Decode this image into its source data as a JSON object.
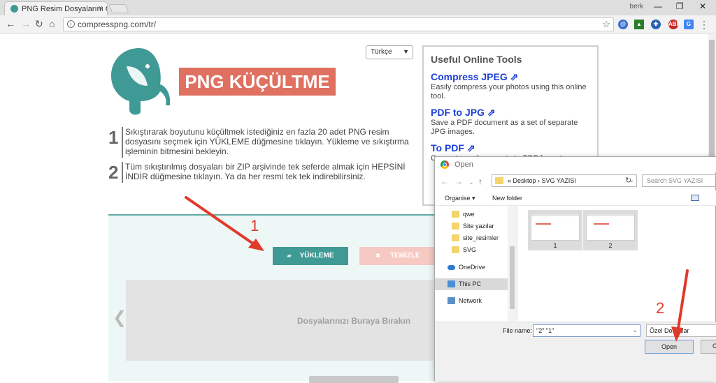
{
  "browser": {
    "tab_title": "PNG Resim Dosyalarını C",
    "tab_close": "×",
    "user_name": "berk",
    "url": "compresspng.com/tr/",
    "window_controls": [
      "—",
      "❐",
      "✕"
    ]
  },
  "page": {
    "title": "PNG KÜÇÜLTME",
    "language_selected": "Türkçe",
    "steps": [
      {
        "number": "1",
        "text": "Sıkıştırarak boyutunu küçültmek istediğiniz en fazla 20 adet PNG resim dosyasını seçmek için YÜKLEME düğmesine tıklayın. Yükleme ve sıkıştırma işleminin bitmesini bekleyin."
      },
      {
        "number": "2",
        "text": "Tüm sıkıştırılmış dosyaları bir ZIP arşivinde tek seferde almak için HEPSİNİ İNDİR düğmesine tıklayın. Ya da her resmi tek tek indirebilirsiniz."
      }
    ],
    "upload_button": "YÜKLEME",
    "clear_button": "TEMİZLE",
    "drop_text": "Dosyalarınızı Buraya Bırakın",
    "prev_arrow": "❮"
  },
  "tools": {
    "heading": "Useful Online Tools",
    "items": [
      {
        "title": "Compress JPEG ⇗",
        "desc": "Easily compress your photos using this online tool."
      },
      {
        "title": "PDF to JPG ⇗",
        "desc": "Save a PDF document as a set of separate JPG images."
      },
      {
        "title": "To PDF ⇗",
        "desc": "Convert any documents to PDF format."
      }
    ]
  },
  "annotations": {
    "first": "1",
    "second": "2",
    "color": "#e03a2a"
  },
  "dialog": {
    "title": "Open",
    "path_prefix": "«",
    "path": "Desktop  ›  SVG YAZISI",
    "search_placeholder": "Search SVG YAZISI",
    "organise": "Organise ▾",
    "new_folder": "New folder",
    "tree": [
      {
        "label": "qwe",
        "type": "folder"
      },
      {
        "label": "Site yazılar",
        "type": "folder"
      },
      {
        "label": "site_resimler",
        "type": "folder"
      },
      {
        "label": "SVG",
        "type": "folder"
      },
      {
        "label": "OneDrive",
        "type": "cloud"
      },
      {
        "label": "This PC",
        "type": "pc"
      },
      {
        "label": "Network",
        "type": "network"
      }
    ],
    "files": [
      {
        "name": "1"
      },
      {
        "name": "2"
      }
    ],
    "file_name_label": "File name:",
    "file_name_value": "\"2\" \"1\"",
    "file_type": "Özel Dosyalar",
    "open_button": "Open",
    "cancel_button": "C"
  },
  "colors": {
    "accent_teal": "#3f9a95",
    "title_red": "#e07060",
    "link_blue": "#1d3fd6",
    "arrow_red": "#e03a2a"
  }
}
